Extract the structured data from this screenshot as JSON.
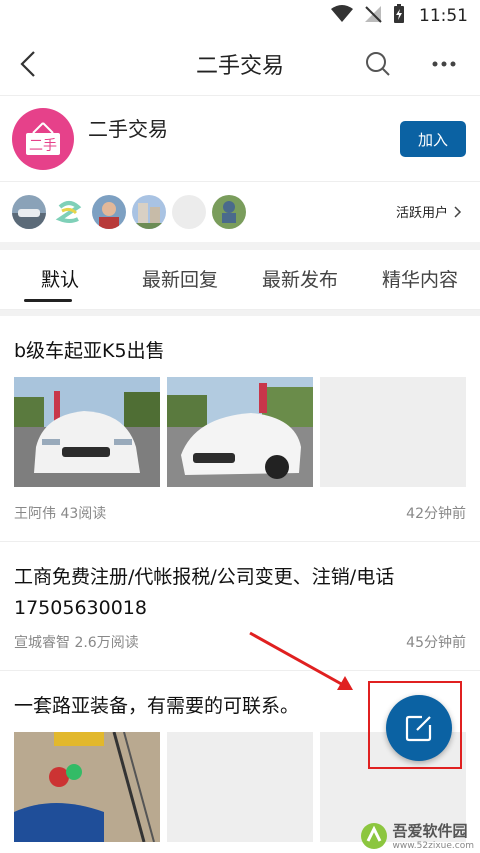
{
  "status_bar": {
    "time": "11:51"
  },
  "navbar": {
    "title": "二手交易"
  },
  "group": {
    "logo_text": "二手",
    "name": "二手交易",
    "join_label": "加入"
  },
  "active_users": {
    "link_label": "活跃用户",
    "count": 6
  },
  "tabs": [
    {
      "label": "默认",
      "active": true
    },
    {
      "label": "最新回复",
      "active": false
    },
    {
      "label": "最新发布",
      "active": false
    },
    {
      "label": "精华内容",
      "active": false
    }
  ],
  "posts": [
    {
      "title": "b级车起亚K5出售",
      "author": "王阿伟",
      "views": "43阅读",
      "time": "42分钟前"
    },
    {
      "title": "工商免费注册/代帐报税/公司变更、注销/电话17505630018",
      "author": "宣城睿智",
      "views": "2.6万阅读",
      "time": "45分钟前"
    },
    {
      "title": "一套路亚装备，有需要的可联系。"
    }
  ],
  "watermark": {
    "text": "吾爱软件园",
    "url": "www.52zixue.com"
  },
  "colors": {
    "accent": "#0b62a3",
    "logo_bg": "#e6418a",
    "annotation": "#e02020"
  }
}
